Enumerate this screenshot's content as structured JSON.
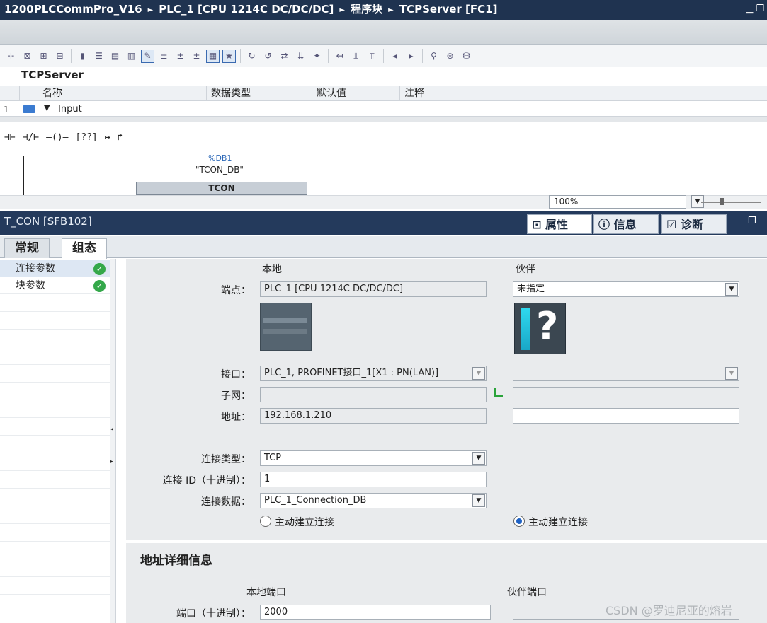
{
  "titlebar": {
    "crumb0": "1200PLCCommPro_V16",
    "crumb1": "PLC_1 [CPU 1214C DC/DC/DC]",
    "crumb2": "程序块",
    "crumb3": "TCPServer [FC1]"
  },
  "editor": {
    "block_name": "TCPServer",
    "columns": {
      "name": "名称",
      "datatype": "数据类型",
      "default": "默认值",
      "comment": "注释"
    },
    "row1_num": "1",
    "row1_name": "Input"
  },
  "network": {
    "db_ref": "%DB1",
    "db_name": "\"TCON_DB\"",
    "block": "TCON"
  },
  "zoom": {
    "value": "100%"
  },
  "inspector": {
    "title": "T_CON [SFB102]",
    "tab_properties": "属性",
    "tab_info": "信息",
    "tab_diag": "诊断"
  },
  "subtabs": {
    "general": "常规",
    "config": "组态"
  },
  "nav": {
    "item1": "连接参数",
    "item2": "块参数"
  },
  "conn": {
    "local_header": "本地",
    "partner_header": "伙伴",
    "endpoint_label": "端点：",
    "local_endpoint": "PLC_1 [CPU 1214C DC/DC/DC]",
    "partner_endpoint": "未指定",
    "interface_label": "接口：",
    "local_interface": "PLC_1, PROFINET接口_1[X1 : PN(LAN)]",
    "partner_interface": "",
    "subnet_label": "子网：",
    "local_subnet": "",
    "partner_subnet": "",
    "address_label": "地址：",
    "local_address": "192.168.1.210",
    "partner_address": "",
    "conn_type_label": "连接类型：",
    "conn_type": "TCP",
    "conn_id_label": "连接 ID（十进制）：",
    "conn_id": "1",
    "conn_data_label": "连接数据：",
    "conn_data": "PLC_1_Connection_DB",
    "local_active_label": "主动建立连接",
    "partner_active_label": "主动建立连接"
  },
  "addr": {
    "title": "地址详细信息",
    "local_port_header": "本地端口",
    "partner_port_header": "伙伴端口",
    "port_label": "端口（十进制）：",
    "local_port": "2000",
    "partner_port": ""
  },
  "watermark": "CSDN @罗迪尼亚的熔岩",
  "colors": {
    "titlebar": "#1f3350",
    "inspector_bar": "#243a5c",
    "check_green": "#34a84a",
    "radio_blue": "#1f62c4"
  }
}
